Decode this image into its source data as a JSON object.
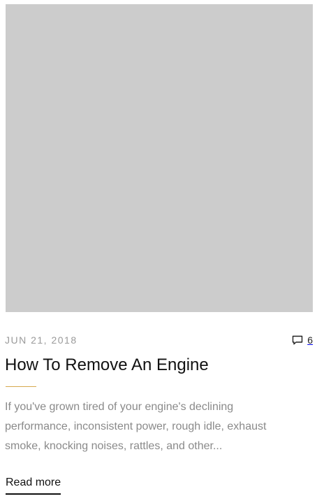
{
  "post": {
    "date": "JUN 21, 2018",
    "comments_count": "6",
    "title": "How To Remove An Engine",
    "excerpt": "If you've grown tired of your engine's declining performance, inconsistent power, rough idle, exhaust smoke, knocking noises, rattles, and other...",
    "read_more_label": "Read more"
  },
  "icons": {
    "comments": "comment-bubble-icon"
  },
  "colors": {
    "image_placeholder": "#cccccc",
    "accent": "#d6a84e",
    "muted_text": "#8a8a8a",
    "title_text": "#111111"
  }
}
